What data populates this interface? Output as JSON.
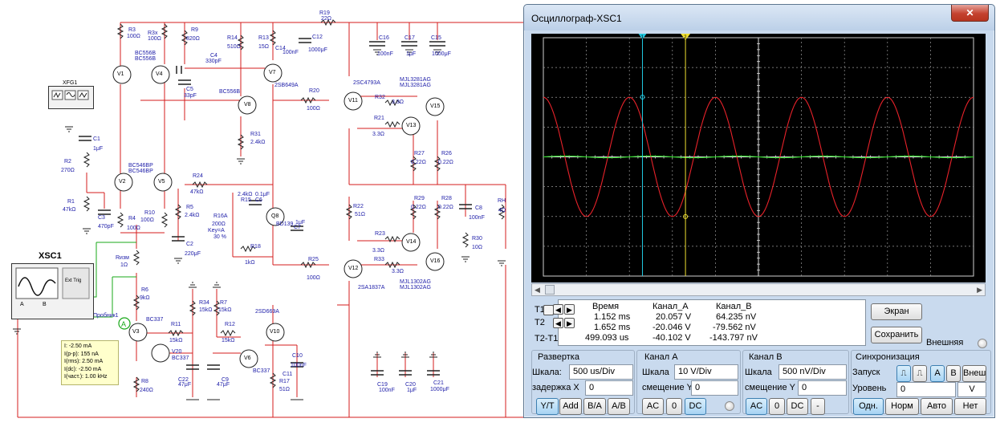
{
  "schematic": {
    "components": {
      "R19": {
        "name": "R19",
        "value": "22Ω"
      },
      "R3": {
        "name": "R3",
        "value": "100Ω"
      },
      "R3x": {
        "name": "R3x",
        "value": "100Ω"
      },
      "R9": {
        "name": "R9",
        "value": "820Ω"
      },
      "R14": {
        "name": "R14",
        "value": "510Ω"
      },
      "R13": {
        "name": "R13",
        "value": "15Ω"
      },
      "C14": {
        "name": "C14",
        "value": "100nF"
      },
      "C12": {
        "name": "C12",
        "value": "1000μF"
      },
      "C16": {
        "name": "C16",
        "value": "100nF"
      },
      "C17": {
        "name": "C17",
        "value": "1μF"
      },
      "C15": {
        "name": "C15",
        "value": "1000μF"
      },
      "V1": "V1",
      "V4": "V4",
      "V4_model": "BC556B",
      "V4_model2": "BC556B",
      "C4": {
        "name": "C4",
        "value": "330pF"
      },
      "V7": "V7",
      "V7_model": "2SB649A",
      "C5": {
        "name": "C5",
        "value": "33pF"
      },
      "V8": "V8",
      "V8_model": "BC556B",
      "XFG1": "XFG1",
      "R20": {
        "name": "R20",
        "value": "100Ω"
      },
      "V11": "V11",
      "V11_model": "2SC4793A",
      "MJL3281": "MJL3281AG",
      "MJL3281b": "MJL3281AG",
      "R32": {
        "name": "R32",
        "value": "3.3Ω"
      },
      "V15": "V15",
      "R21": {
        "name": "R21",
        "value": "3.3Ω"
      },
      "V13": "V13",
      "R31": {
        "name": "R31",
        "value": "2.4kΩ"
      },
      "C1": {
        "name": "C1",
        "value": "1μF"
      },
      "R27": {
        "name": "R27",
        "value": "0.22Ω"
      },
      "R26": {
        "name": "R26",
        "value": "0.22Ω"
      },
      "R2": {
        "name": "R2",
        "value": "270Ω"
      },
      "V2": "V2",
      "V5": "V5",
      "V2_model": "BC546BP",
      "V2_model2": "BC546BP",
      "R24": {
        "name": "R24",
        "value": "47kΩ"
      },
      "R1": {
        "name": "R1",
        "value": "47kΩ"
      },
      "C3": {
        "name": "C3",
        "value": "470pF"
      },
      "R4": {
        "name": "R4",
        "value": "100Ω"
      },
      "R10": {
        "name": "R10",
        "value": "100Ω"
      },
      "R5": {
        "name": "R5",
        "value": "2.4kΩ"
      },
      "R15": {
        "name": "R15",
        "value": "200Ω"
      },
      "C6": {
        "name": "C6",
        "value": "0.1μF"
      },
      "C6v": "2.4kΩ",
      "R16A": {
        "name": "R16A",
        "value": "200Ω"
      },
      "R16A_key": "Key=A",
      "R16A_pct": "30 %",
      "Q8": "Q8",
      "Q8_model": "BD139",
      "C7": {
        "name": "C7",
        "value": "1μF"
      },
      "R22": {
        "name": "R22",
        "value": "51Ω"
      },
      "R29": {
        "name": "R29",
        "value": "0.22Ω"
      },
      "R28": {
        "name": "R28",
        "value": "0.22Ω"
      },
      "C8": {
        "name": "C8",
        "value": "100nF"
      },
      "RH": {
        "name": "RH",
        "value": "4Ω"
      },
      "R30": {
        "name": "R30",
        "value": "10Ω"
      },
      "C2": {
        "name": "C2",
        "value": "220μF"
      },
      "R18": {
        "name": "R18",
        "value": "1kΩ"
      },
      "R23": {
        "name": "R23",
        "value": "3.3Ω"
      },
      "V14": "V14",
      "Rizm": {
        "name": "Rизм",
        "value": "1Ω"
      },
      "R25": {
        "name": "R25",
        "value": "100Ω"
      },
      "V12": "V12",
      "V12_model": "2SA1837A",
      "R33": {
        "name": "R33",
        "value": "3.3Ω"
      },
      "V16": "V16",
      "MJL1302": "MJL1302AG",
      "MJL1302b": "MJL1302AG",
      "R6": {
        "name": "R6",
        "value": "9kΩ"
      },
      "R34": {
        "name": "R34",
        "value": "15kΩ"
      },
      "R7": {
        "name": "R7",
        "value": "15kΩ"
      },
      "V10": "V10",
      "V10_model": "2SD669A",
      "probe": "Пробник1",
      "V3": "V3",
      "V3_model": "BC337",
      "R11": {
        "name": "R11",
        "value": "15kΩ"
      },
      "R12": {
        "name": "R12",
        "value": "15kΩ"
      },
      "V20": "V20",
      "V20_model": "BC337",
      "C22": {
        "name": "C22",
        "value": "47μF"
      },
      "C9": {
        "name": "C9",
        "value": "47μF"
      },
      "V6": "V6",
      "V6_model": "BC337",
      "C10": {
        "name": "C10",
        "value": "100nF"
      },
      "C11": "C11",
      "R8": {
        "name": "R8",
        "value": "240Ω"
      },
      "R17": {
        "name": "R17",
        "value": "51Ω"
      },
      "C19": {
        "name": "C19",
        "value": "100nF"
      },
      "C20": {
        "name": "C20",
        "value": "1μF"
      },
      "C21": {
        "name": "C21",
        "value": "1000μF"
      }
    },
    "xsc1": {
      "label": "XSC1",
      "ext_trig": "Ext Trig",
      "a": "A",
      "b": "B"
    },
    "probe_readout": [
      "I: -2.50 mA",
      "I(p-p): 155 nA",
      "I(rms): 2.50 mA",
      "I(dc): -2.50 mA",
      "I(част.): 1.00 kHz"
    ]
  },
  "osc": {
    "title": "Осциллограф-XSC1",
    "close": "✕",
    "cursor1": "1",
    "cursor2": "2",
    "readout": {
      "h_time": "Время",
      "h_a": "Канал_A",
      "h_b": "Канал_B",
      "t1": "T1",
      "t2": "T2",
      "t21": "T2-T1",
      "r1": [
        "1.152 ms",
        "20.057 V",
        "64.235 nV"
      ],
      "r2": [
        "1.652 ms",
        "-20.046 V",
        "-79.562 nV"
      ],
      "r3": [
        "499.093 us",
        "-40.102 V",
        "-143.797 nV"
      ]
    },
    "screen_btn": "Экран",
    "save_btn": "Сохранить",
    "ext_label": "Внешняя",
    "sweep": {
      "title": "Развертка",
      "scale_label": "Шкала:",
      "scale": "500 us/Div",
      "delay_label": "задержка X",
      "delay": "0",
      "modes": [
        "Y/T",
        "Add",
        "B/A",
        "A/B"
      ]
    },
    "chA": {
      "title": "Канал А",
      "scale_label": "Шкала",
      "scale": "10  V/Div",
      "offset_label": "смещение Y",
      "offset": "0",
      "modes": [
        "AC",
        "0",
        "DC"
      ]
    },
    "chB": {
      "title": "Канал В",
      "scale_label": "Шкала",
      "scale": "500 nV/Div",
      "offset_label": "смещение Y",
      "offset": "0",
      "modes": [
        "AC",
        "0",
        "DC",
        "-"
      ]
    },
    "trig": {
      "title": "Синхронизация",
      "start_label": "Запуск",
      "level_label": "Уровень",
      "level": "0",
      "unit": "V",
      "src": [
        "A",
        "B",
        "Внеш"
      ],
      "modes": [
        "Одн.",
        "Норм",
        "Авто",
        "Нет"
      ]
    },
    "colors": {
      "chA": "#e8222a",
      "chB": "#26d420",
      "cursor1": "#20c8e0",
      "cursor2": "#f0e030",
      "screen": "#000000"
    }
  },
  "chart_data": {
    "type": "line",
    "xlabel": "",
    "ylabel": "",
    "x_range": [
      0,
      5
    ],
    "series": [
      {
        "name": "Канал_A",
        "amplitude": 20,
        "frequency_khz": 1,
        "phase_deg": 90
      },
      {
        "name": "Канал_B",
        "amplitude": 1e-07,
        "frequency_khz": 1
      }
    ]
  }
}
